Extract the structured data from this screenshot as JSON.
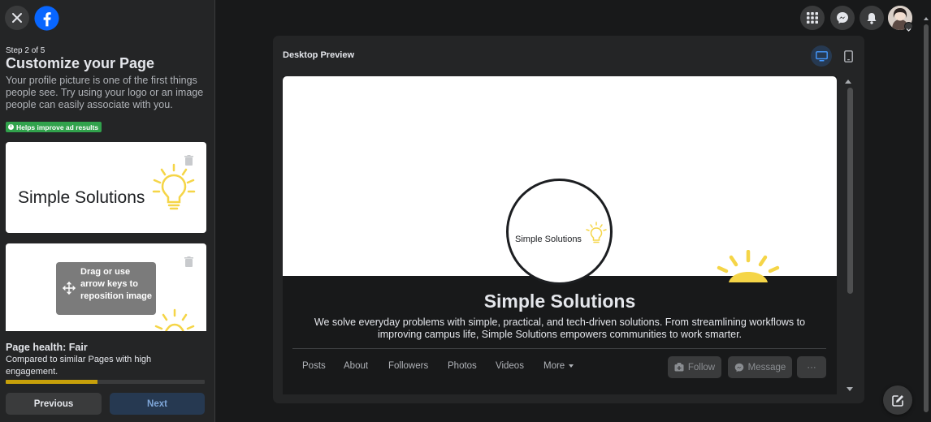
{
  "left_panel": {
    "step": "Step 2 of 5",
    "title": "Customize your Page",
    "description": "Your profile picture is one of the first things people see. Try using your logo or an image people can easily associate with you.",
    "badge": "Helps improve ad results",
    "cover_logo_text": "Simple Solutions",
    "drag_hint": "Drag or use arrow keys to reposition image",
    "health_title": "Page health: Fair",
    "health_desc": "Compared to similar Pages with high engagement.",
    "health_progress": 0.46,
    "previous_label": "Previous",
    "next_label": "Next"
  },
  "preview": {
    "title": "Desktop Preview",
    "profile_text": "Simple Solutions",
    "page_name": "Simple Solutions",
    "bio": "We solve everyday problems with simple, practical, and tech-driven solutions. From streamlining workflows to improving campus life, Simple Solutions empowers communities to work smarter.",
    "tabs": [
      "Posts",
      "About",
      "Followers",
      "Photos",
      "Videos",
      "More"
    ],
    "follow_label": "Follow",
    "message_label": "Message",
    "more_actions": "···"
  },
  "icons": {
    "close": "close-icon",
    "logo": "facebook-logo-icon",
    "menu": "grid-menu-icon",
    "messenger": "messenger-icon",
    "notifications": "bell-icon",
    "desktop": "desktop-icon",
    "mobile": "mobile-icon",
    "compose": "compose-icon"
  },
  "colors": {
    "fb_blue": "#0866ff",
    "badge_green": "#31a24c",
    "progress_fill": "#c7a00a",
    "bulb_yellow": "#f5d547"
  }
}
